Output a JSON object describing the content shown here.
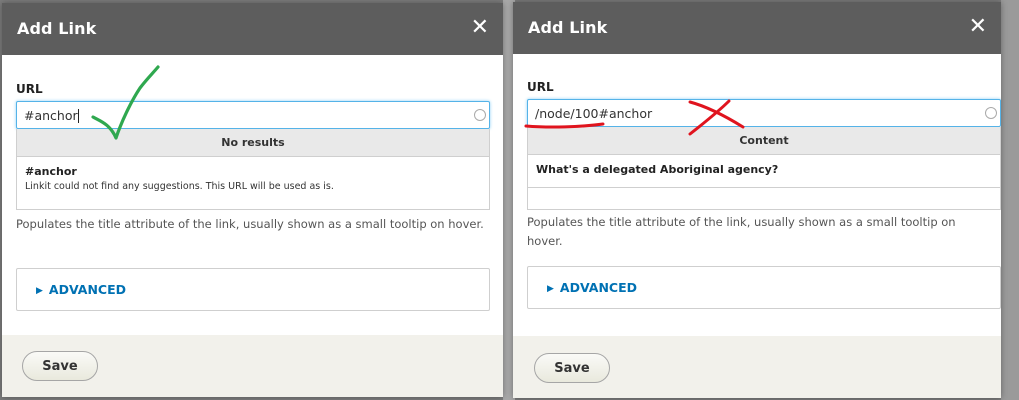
{
  "left_dialog": {
    "title": "Add Link",
    "close_glyph": "✕",
    "url_label": "URL",
    "url_value": "#anchor",
    "results_header": "No results",
    "result_title": "#anchor",
    "result_subtitle": "Linkit could not find any suggestions. This URL will be used as is.",
    "help_text": "Populates the title attribute of the link, usually shown as a small tooltip on hover.",
    "advanced_label": "ADVANCED",
    "save_label": "Save",
    "annotation": "green-checkmark"
  },
  "right_dialog": {
    "title": "Add Link",
    "close_glyph": "✕",
    "url_label": "URL",
    "url_value": "/node/100#anchor",
    "results_header": "Content",
    "result_title": "What's a delegated Aboriginal agency?",
    "help_text": "Populates the title attribute of the link, usually shown as a small tooltip on hover.",
    "advanced_label": "ADVANCED",
    "save_label": "Save",
    "annotation": "red-cross"
  },
  "colors": {
    "titlebar": "#5d5d5d",
    "link_blue": "#0071b3",
    "focus_border": "#55b3e8",
    "annotation_green": "#2fa84f",
    "annotation_red": "#e0141e"
  }
}
